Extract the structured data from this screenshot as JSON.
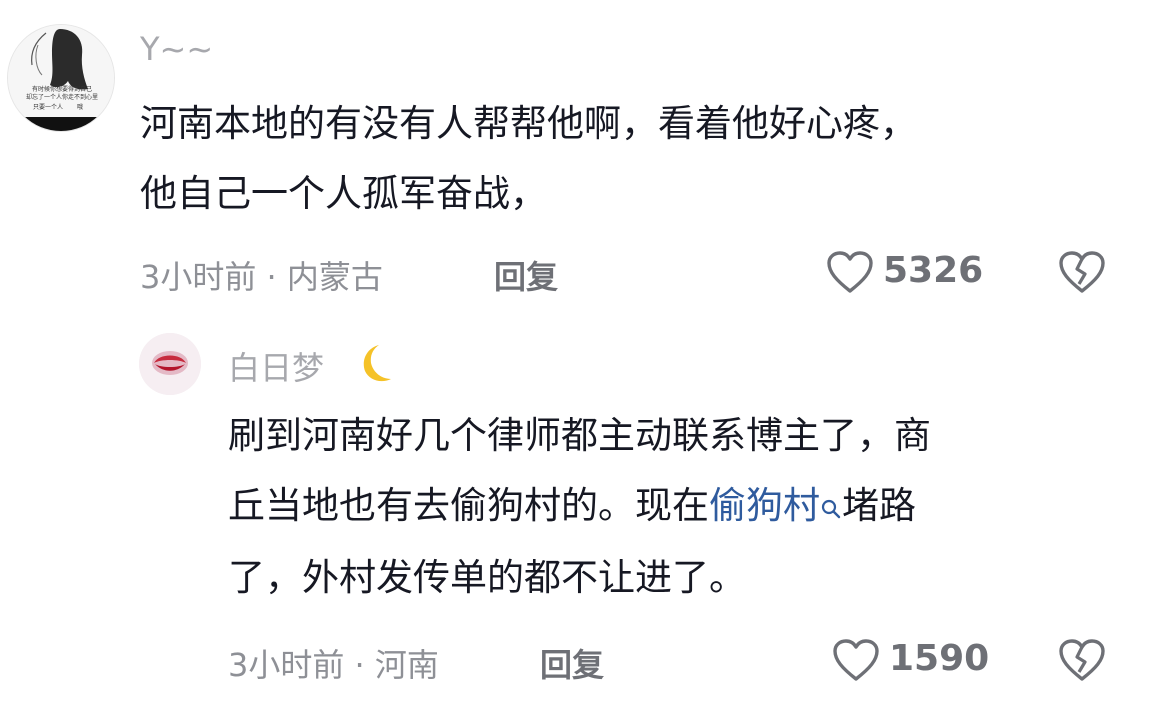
{
  "comments": [
    {
      "username": "Y~~",
      "content_line1": "河南本地的有没有人帮帮他啊，看着他好心疼，",
      "content_line2": "他自己一个人孤军奋战，",
      "meta": "3小时前 · 内蒙古",
      "reply_label": "回复",
      "likes": "5326",
      "avatar_text": [
        "有时候你想要得到自己",
        "却忘了一个人你走不到心里",
        "只要一个人",
        "哦"
      ]
    },
    {
      "username": "白日梦",
      "emoji": "🌙",
      "content_line1": "刷到河南好几个律师都主动联系博主了，商",
      "content_line2_before": "丘当地也有去偷狗村的。现在",
      "content_line2_link": "偷狗村",
      "content_line2_after": "堵路",
      "content_line3": "了，外村发传单的都不让进了。",
      "meta": "3小时前 · 河南",
      "reply_label": "回复",
      "likes": "1590"
    }
  ],
  "colors": {
    "link": "#2f5b9e",
    "text": "#161823",
    "meta": "#8e9096"
  },
  "icons": [
    "heart-outline-icon",
    "broken-heart-icon",
    "search-icon",
    "crescent-moon-icon"
  ]
}
